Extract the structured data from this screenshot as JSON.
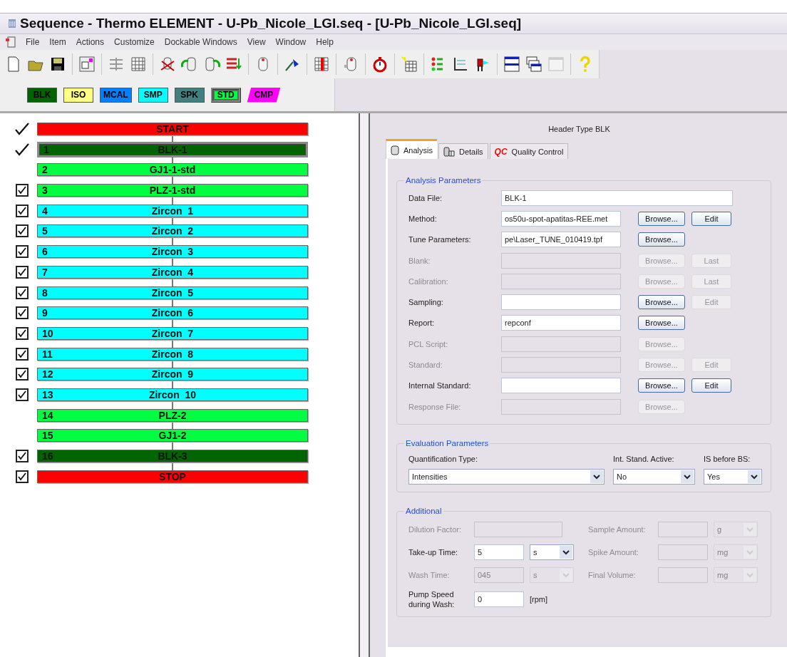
{
  "window": {
    "title": "Sequence - Thermo ELEMENT - U-Pb_Nicole_LGI.seq - [U-Pb_Nicole_LGI.seq]"
  },
  "menu": [
    "File",
    "Item",
    "Actions",
    "Customize",
    "Dockable Windows",
    "View",
    "Window",
    "Help"
  ],
  "type_buttons": [
    {
      "label": "BLK",
      "color": "#006400",
      "selected": false,
      "kind": "rect"
    },
    {
      "label": "ISO",
      "color": "#ffff80",
      "selected": false,
      "kind": "rect"
    },
    {
      "label": "MCAL",
      "color": "#0080ff",
      "selected": false,
      "kind": "rect"
    },
    {
      "label": "SMP",
      "color": "#00ffff",
      "selected": false,
      "kind": "rect"
    },
    {
      "label": "SPK",
      "color": "#408080",
      "selected": false,
      "kind": "rect"
    },
    {
      "label": "STD",
      "color": "#00ff40",
      "selected": true,
      "kind": "rect"
    },
    {
      "label": "CMP",
      "color": "#ff00ff",
      "selected": false,
      "kind": "slant"
    }
  ],
  "sequence": [
    {
      "name": "START",
      "color": "#ff0000",
      "kind": "done",
      "selected": false
    },
    {
      "number": "1",
      "name": "BLK-1",
      "color": "#006400",
      "kind": "done",
      "selected": true
    },
    {
      "number": "2",
      "name": "GJ1-1-std",
      "color": "#00ff40",
      "selected": false
    },
    {
      "number": "3",
      "name": "PLZ-1-std",
      "color": "#00ff40",
      "kind": "checkbox",
      "checked": true,
      "selected": false
    },
    {
      "number": "4",
      "name": "Zircon  1",
      "color": "#00ffff",
      "kind": "checkbox",
      "checked": true,
      "selected": false
    },
    {
      "number": "5",
      "name": "Zircon  2",
      "color": "#00ffff",
      "kind": "checkbox",
      "checked": true,
      "selected": false
    },
    {
      "number": "6",
      "name": "Zircon  3",
      "color": "#00ffff",
      "kind": "checkbox",
      "checked": true,
      "selected": false
    },
    {
      "number": "7",
      "name": "Zircon  4",
      "color": "#00ffff",
      "kind": "checkbox",
      "checked": true,
      "selected": false
    },
    {
      "number": "8",
      "name": "Zircon  5",
      "color": "#00ffff",
      "kind": "checkbox",
      "checked": true,
      "selected": false
    },
    {
      "number": "9",
      "name": "Zircon  6",
      "color": "#00ffff",
      "kind": "checkbox",
      "checked": true,
      "selected": false
    },
    {
      "number": "10",
      "name": "Zircon  7",
      "color": "#00ffff",
      "kind": "checkbox",
      "checked": true,
      "selected": false
    },
    {
      "number": "11",
      "name": "Zircon  8",
      "color": "#00ffff",
      "kind": "checkbox",
      "checked": true,
      "selected": false
    },
    {
      "number": "12",
      "name": "Zircon  9",
      "color": "#00ffff",
      "kind": "checkbox",
      "checked": true,
      "selected": false
    },
    {
      "number": "13",
      "name": "Zircon  10",
      "color": "#00ffff",
      "kind": "checkbox",
      "checked": true,
      "selected": false
    },
    {
      "number": "14",
      "name": "PLZ-2",
      "color": "#00ff40",
      "selected": false
    },
    {
      "number": "15",
      "name": "GJ1-2",
      "color": "#00ff40",
      "selected": false
    },
    {
      "number": "16",
      "name": "BLK-3",
      "color": "#006400",
      "kind": "checkbox",
      "checked": true,
      "selected": false
    },
    {
      "name": "STOP",
      "color": "#ff0000",
      "kind": "checkbox",
      "checked": true,
      "selected": false
    }
  ],
  "header": {
    "title": "Header Type BLK"
  },
  "tabs": [
    {
      "label": "Analysis",
      "selected": true
    },
    {
      "label": "Details",
      "selected": false
    },
    {
      "badge": "QC",
      "label": "Quality Control",
      "selected": false
    }
  ],
  "analysis_parameters": {
    "title": "Analysis Parameters",
    "rows": [
      {
        "label": "Data File:",
        "value": "BLK-1",
        "disabled": false,
        "kind": "wide"
      },
      {
        "label": "Method:",
        "value": "os50u-spot-apatitas-REE.met",
        "disabled": false,
        "buttons": [
          {
            "label": "Browse...",
            "disabled": false
          },
          {
            "label": "Edit",
            "disabled": false
          }
        ]
      },
      {
        "label": "Tune Parameters:",
        "value": "pe\\Laser_TUNE_010419.tpf",
        "disabled": false,
        "buttons": [
          {
            "label": "Browse...",
            "disabled": false
          }
        ]
      },
      {
        "label": "Blank:",
        "disabled": true,
        "buttons": [
          {
            "label": "Browse...",
            "disabled": true
          },
          {
            "label": "Last",
            "disabled": true
          }
        ]
      },
      {
        "label": "Calibration:",
        "disabled": true,
        "buttons": [
          {
            "label": "Browse...",
            "disabled": true
          },
          {
            "label": "Last",
            "disabled": true
          }
        ]
      },
      {
        "label": "Sampling:",
        "disabled": false,
        "buttons": [
          {
            "label": "Browse...",
            "disabled": false
          },
          {
            "label": "Edit",
            "disabled": true
          }
        ]
      },
      {
        "label": "Report:",
        "value": "repconf",
        "disabled": false,
        "buttons": [
          {
            "label": "Browse...",
            "disabled": false
          }
        ]
      },
      {
        "label": "PCL Script:",
        "disabled": true,
        "buttons": [
          {
            "label": "Browse...",
            "disabled": true
          }
        ]
      },
      {
        "label": "Standard:",
        "disabled": true,
        "buttons": [
          {
            "label": "Browse...",
            "disabled": true
          },
          {
            "label": "Edit",
            "disabled": true
          }
        ]
      },
      {
        "label": "Internal Standard:",
        "disabled": false,
        "buttons": [
          {
            "label": "Browse...",
            "disabled": false
          },
          {
            "label": "Edit",
            "disabled": false
          }
        ]
      },
      {
        "label": "Response File:",
        "disabled": true,
        "buttons": [
          {
            "label": "Browse...",
            "disabled": true
          }
        ]
      }
    ]
  },
  "evaluation_parameters": {
    "title": "Evaluation Parameters",
    "fields": [
      {
        "label": "Quantification Type:",
        "value": "Intensities"
      },
      {
        "label": "Int. Stand. Active:",
        "value": "No"
      },
      {
        "label": "IS before BS:",
        "value": "Yes"
      }
    ]
  },
  "additional": {
    "title": "Additional",
    "left": [
      {
        "label": "Dilution Factor:",
        "disabled": true,
        "kind": "wide"
      },
      {
        "label": "Take-up Time:",
        "value": "5",
        "unit": "s",
        "disabled": false,
        "kind": "unit_select"
      },
      {
        "label": "Wash Time:",
        "value": "045",
        "unit": "s",
        "disabled": true,
        "kind": "unit_select"
      },
      {
        "label": "Pump Speed during Wash:",
        "value": "0",
        "unit": "[rpm]",
        "disabled": false,
        "kind": "unit_text"
      }
    ],
    "right": [
      {
        "label": "Sample Amount:",
        "unit": "g",
        "disabled": true
      },
      {
        "label": "Spike Amount:",
        "unit": "mg",
        "disabled": true
      },
      {
        "label": "Final Volume:",
        "unit": "mg",
        "disabled": true
      }
    ]
  }
}
